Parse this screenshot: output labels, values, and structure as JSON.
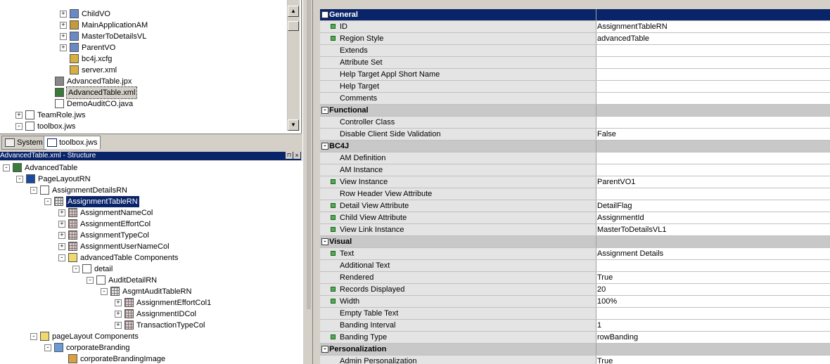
{
  "navigator": {
    "items": [
      {
        "label": "ChildVO",
        "icon": "view-object-icon",
        "expand": "+"
      },
      {
        "label": "MainApplicationAM",
        "icon": "application-module-icon",
        "expand": "+"
      },
      {
        "label": "MasterToDetailsVL",
        "icon": "view-link-icon",
        "expand": "+"
      },
      {
        "label": "ParentVO",
        "icon": "view-object-icon",
        "expand": "+"
      },
      {
        "label": "bc4j.xcfg",
        "icon": "config-icon",
        "expand": ""
      },
      {
        "label": "server.xml",
        "icon": "config-icon",
        "expand": ""
      },
      {
        "label": "AdvancedTable.jpx",
        "icon": "project-icon",
        "expand": ""
      },
      {
        "label": "AdvancedTable.xml",
        "icon": "xml-file-icon",
        "expand": ""
      },
      {
        "label": "DemoAuditCO.java",
        "icon": "java-file-icon",
        "expand": ""
      },
      {
        "label": "TeamRole.jws",
        "icon": "workspace-icon",
        "expand": "+"
      },
      {
        "label": "toolbox.jws",
        "icon": "workspace-icon",
        "expand": "-"
      }
    ]
  },
  "tabs": {
    "system": "System",
    "toolbox": "toolbox.jws"
  },
  "structure": {
    "title": "AdvancedTable.xml - Structure",
    "items": [
      {
        "label": "AdvancedTable",
        "icon": "page-icon",
        "expand": "-"
      },
      {
        "label": "PageLayoutRN",
        "icon": "page-layout-icon",
        "expand": "-"
      },
      {
        "label": "AssignmentDetailsRN",
        "icon": "region-icon",
        "expand": "-"
      },
      {
        "label": "AssignmentTableRN",
        "icon": "table-icon",
        "expand": "-"
      },
      {
        "label": "AssignmentNameCol",
        "icon": "column-icon",
        "expand": "+"
      },
      {
        "label": "AssignmentEffortCol",
        "icon": "column-icon",
        "expand": "+"
      },
      {
        "label": "AssignmentTypeCol",
        "icon": "column-icon",
        "expand": "+"
      },
      {
        "label": "AssignmentUserNameCol",
        "icon": "column-icon",
        "expand": "+"
      },
      {
        "label": "advancedTable Components",
        "icon": "folder-icon",
        "expand": "-"
      },
      {
        "label": "detail",
        "icon": "detail-icon",
        "expand": "-"
      },
      {
        "label": "AuditDetailRN",
        "icon": "region-icon",
        "expand": "-"
      },
      {
        "label": "AsgmtAuditTableRN",
        "icon": "table-icon",
        "expand": "-"
      },
      {
        "label": "AssignmentEffortCol1",
        "icon": "column-icon",
        "expand": "+"
      },
      {
        "label": "AssignmentIDCol",
        "icon": "column-icon",
        "expand": "+"
      },
      {
        "label": "TransactionTypeCol",
        "icon": "column-icon",
        "expand": "+"
      },
      {
        "label": "pageLayout Components",
        "icon": "folder-icon",
        "expand": "-"
      },
      {
        "label": "corporateBranding",
        "icon": "image-region-icon",
        "expand": "-"
      },
      {
        "label": "corporateBrandingImage",
        "icon": "image-icon",
        "expand": ""
      }
    ]
  },
  "inspector": {
    "rows": [
      {
        "cat": true,
        "name": "General",
        "value": ""
      },
      {
        "name": "ID",
        "value": "AssignmentTableRN",
        "req": true
      },
      {
        "name": "Region Style",
        "value": "advancedTable",
        "req": true
      },
      {
        "name": "Extends",
        "value": ""
      },
      {
        "name": "Attribute Set",
        "value": ""
      },
      {
        "name": "Help Target Appl Short Name",
        "value": ""
      },
      {
        "name": "Help Target",
        "value": ""
      },
      {
        "name": "Comments",
        "value": ""
      },
      {
        "cat": true,
        "name": "Functional",
        "value": ""
      },
      {
        "name": "Controller Class",
        "value": ""
      },
      {
        "name": "Disable Client Side Validation",
        "value": "False"
      },
      {
        "cat": true,
        "name": "BC4J",
        "value": ""
      },
      {
        "name": "AM Definition",
        "value": ""
      },
      {
        "name": "AM Instance",
        "value": ""
      },
      {
        "name": "View Instance",
        "value": "ParentVO1",
        "req": true
      },
      {
        "name": "Row Header View Attribute",
        "value": ""
      },
      {
        "name": "Detail View Attribute",
        "value": "DetailFlag",
        "req": true
      },
      {
        "name": "Child View Attribute",
        "value": "AssignmentId",
        "req": true
      },
      {
        "name": "View Link Instance",
        "value": "MasterToDetailsVL1",
        "req": true
      },
      {
        "cat": true,
        "name": "Visual",
        "value": ""
      },
      {
        "name": "Text",
        "value": "Assignment Details",
        "req": true
      },
      {
        "name": "Additional Text",
        "value": ""
      },
      {
        "name": "Rendered",
        "value": "True"
      },
      {
        "name": "Records Displayed",
        "value": "20",
        "req": true
      },
      {
        "name": "Width",
        "value": "100%",
        "req": true
      },
      {
        "name": "Empty Table Text",
        "value": ""
      },
      {
        "name": "Banding Interval",
        "value": "1"
      },
      {
        "name": "Banding Type",
        "value": "rowBanding",
        "req": true
      },
      {
        "cat": true,
        "name": "Personalization",
        "value": ""
      },
      {
        "name": "Admin Personalization",
        "value": "True"
      }
    ]
  }
}
